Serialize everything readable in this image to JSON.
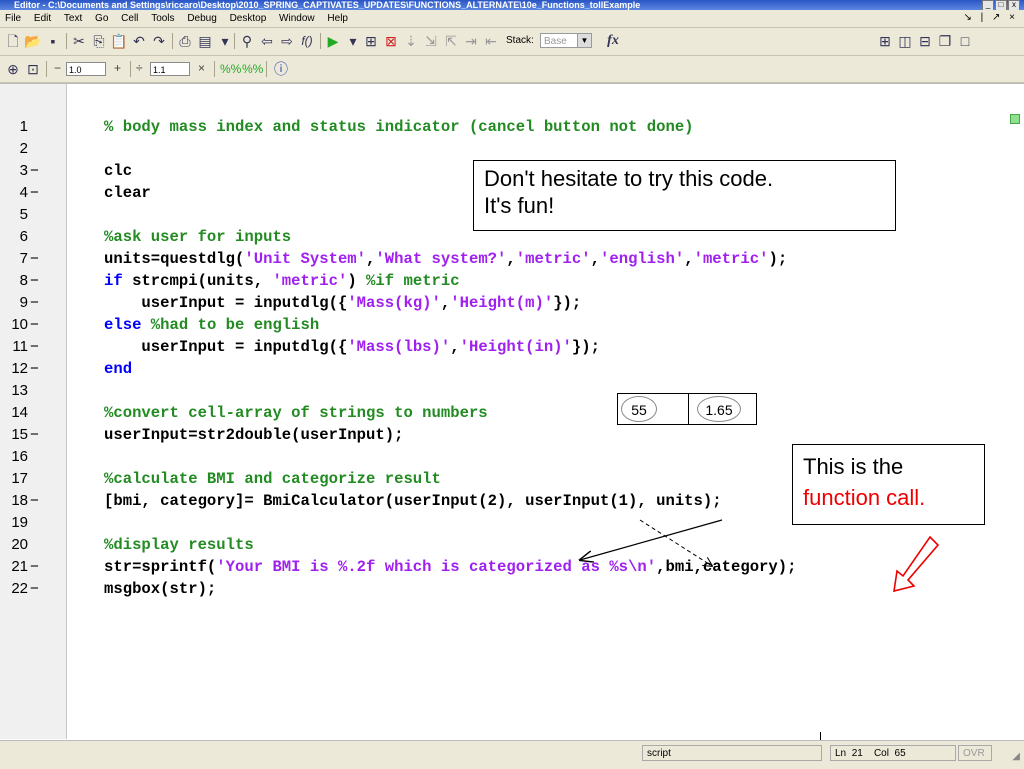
{
  "window": {
    "title": "Editor - C:\\Documents and Settings\\riccaro\\Desktop\\2010_SPRING_CAPTIVATES_UPDATES\\FUNCTIONS_ALTERNATE\\10e_Functions_tollExample"
  },
  "menu": {
    "items": [
      "File",
      "Edit",
      "Text",
      "Go",
      "Cell",
      "Tools",
      "Debug",
      "Desktop",
      "Window",
      "Help"
    ]
  },
  "toolbar": {
    "icons": [
      "new-file-icon",
      "open-file-icon",
      "save-icon",
      "cut-icon",
      "copy-icon",
      "paste-icon",
      "undo-icon",
      "redo-icon",
      "print-icon",
      "find-icon",
      "binoculars-icon",
      "back-icon",
      "forward-icon",
      "fx-function-icon",
      "run-icon",
      "set-breakpoint-icon",
      "clear-breakpoint-icon",
      "step-icon",
      "step-in-icon",
      "step-out-icon",
      "continue-icon",
      "exit-debug-icon"
    ],
    "stack_label": "Stack:",
    "stack_value": "Base",
    "fx_label": "fx"
  },
  "cell_toolbar": {
    "minus": "−",
    "value1": "1.0",
    "plus": "+",
    "divide": "÷",
    "value2": "1.1",
    "times": "×"
  },
  "code_lines": [
    {
      "n": "1",
      "dash": "",
      "segments": [
        {
          "t": "% body mass index and status indicator (cancel button not done)",
          "c": "cmt"
        }
      ]
    },
    {
      "n": "2",
      "dash": "",
      "segments": []
    },
    {
      "n": "3",
      "dash": "−",
      "segments": [
        {
          "t": "clc",
          "c": "nm"
        }
      ]
    },
    {
      "n": "4",
      "dash": "−",
      "segments": [
        {
          "t": "clear",
          "c": "nm"
        }
      ]
    },
    {
      "n": "5",
      "dash": "",
      "segments": []
    },
    {
      "n": "6",
      "dash": "",
      "segments": [
        {
          "t": "%ask user for inputs",
          "c": "cmt"
        }
      ]
    },
    {
      "n": "7",
      "dash": "−",
      "segments": [
        {
          "t": "units=questdlg(",
          "c": "nm"
        },
        {
          "t": "'Unit System'",
          "c": "str"
        },
        {
          "t": ",",
          "c": "nm"
        },
        {
          "t": "'What system?'",
          "c": "str"
        },
        {
          "t": ",",
          "c": "nm"
        },
        {
          "t": "'metric'",
          "c": "str"
        },
        {
          "t": ",",
          "c": "nm"
        },
        {
          "t": "'english'",
          "c": "str"
        },
        {
          "t": ",",
          "c": "nm"
        },
        {
          "t": "'metric'",
          "c": "str"
        },
        {
          "t": ");",
          "c": "nm"
        }
      ]
    },
    {
      "n": "8",
      "dash": "−",
      "segments": [
        {
          "t": "if ",
          "c": "kw"
        },
        {
          "t": "strcmpi(units, ",
          "c": "nm"
        },
        {
          "t": "'metric'",
          "c": "str"
        },
        {
          "t": ") ",
          "c": "nm"
        },
        {
          "t": "%if metric",
          "c": "cmt"
        }
      ]
    },
    {
      "n": "9",
      "dash": "−",
      "segments": [
        {
          "t": "    userInput = inputdlg({",
          "c": "nm"
        },
        {
          "t": "'Mass(kg)'",
          "c": "str"
        },
        {
          "t": ",",
          "c": "nm"
        },
        {
          "t": "'Height(m)'",
          "c": "str"
        },
        {
          "t": "});",
          "c": "nm"
        }
      ]
    },
    {
      "n": "10",
      "dash": "−",
      "segments": [
        {
          "t": "else ",
          "c": "kw"
        },
        {
          "t": "%had to be english",
          "c": "cmt"
        }
      ]
    },
    {
      "n": "11",
      "dash": "−",
      "segments": [
        {
          "t": "    userInput = inputdlg({",
          "c": "nm"
        },
        {
          "t": "'Mass(lbs)'",
          "c": "str"
        },
        {
          "t": ",",
          "c": "nm"
        },
        {
          "t": "'Height(in)'",
          "c": "str"
        },
        {
          "t": "});",
          "c": "nm"
        }
      ]
    },
    {
      "n": "12",
      "dash": "−",
      "segments": [
        {
          "t": "end",
          "c": "kw"
        }
      ]
    },
    {
      "n": "13",
      "dash": "",
      "segments": []
    },
    {
      "n": "14",
      "dash": "",
      "segments": [
        {
          "t": "%convert cell-array of strings to numbers",
          "c": "cmt"
        }
      ]
    },
    {
      "n": "15",
      "dash": "−",
      "segments": [
        {
          "t": "userInput=str2double(userInput);",
          "c": "nm"
        }
      ]
    },
    {
      "n": "16",
      "dash": "",
      "segments": []
    },
    {
      "n": "17",
      "dash": "",
      "segments": [
        {
          "t": "%calculate BMI and categorize result",
          "c": "cmt"
        }
      ]
    },
    {
      "n": "18",
      "dash": "−",
      "segments": [
        {
          "t": "[bmi, category]= BmiCalculator(userInput(2), userInput(1), units);",
          "c": "nm"
        }
      ]
    },
    {
      "n": "19",
      "dash": "",
      "segments": []
    },
    {
      "n": "20",
      "dash": "",
      "segments": [
        {
          "t": "%display results",
          "c": "cmt"
        }
      ]
    },
    {
      "n": "21",
      "dash": "−",
      "segments": [
        {
          "t": "str=sprintf(",
          "c": "nm"
        },
        {
          "t": "'Your BMI is %.2f which is categorized as %s\\n'",
          "c": "str"
        },
        {
          "t": ",bmi,category);",
          "c": "nm"
        }
      ]
    },
    {
      "n": "22",
      "dash": "−",
      "segments": [
        {
          "t": "msgbox(str);",
          "c": "nm"
        }
      ]
    }
  ],
  "callout_try": {
    "line1": "Don't hesitate to try this code.",
    "line2": "It's fun!"
  },
  "callout_call": {
    "line1": "This is the",
    "line2": "function call."
  },
  "cell_array": {
    "v1": "55",
    "v2": "1.65"
  },
  "status": {
    "mode": "script",
    "ln_label": "Ln",
    "ln": "21",
    "col_label": "Col",
    "col": "65",
    "ovr": "OVR"
  },
  "colors": {
    "comment": "#228b22",
    "keyword": "#0000ff",
    "string": "#a020f0",
    "callout_red": "#e00000"
  }
}
